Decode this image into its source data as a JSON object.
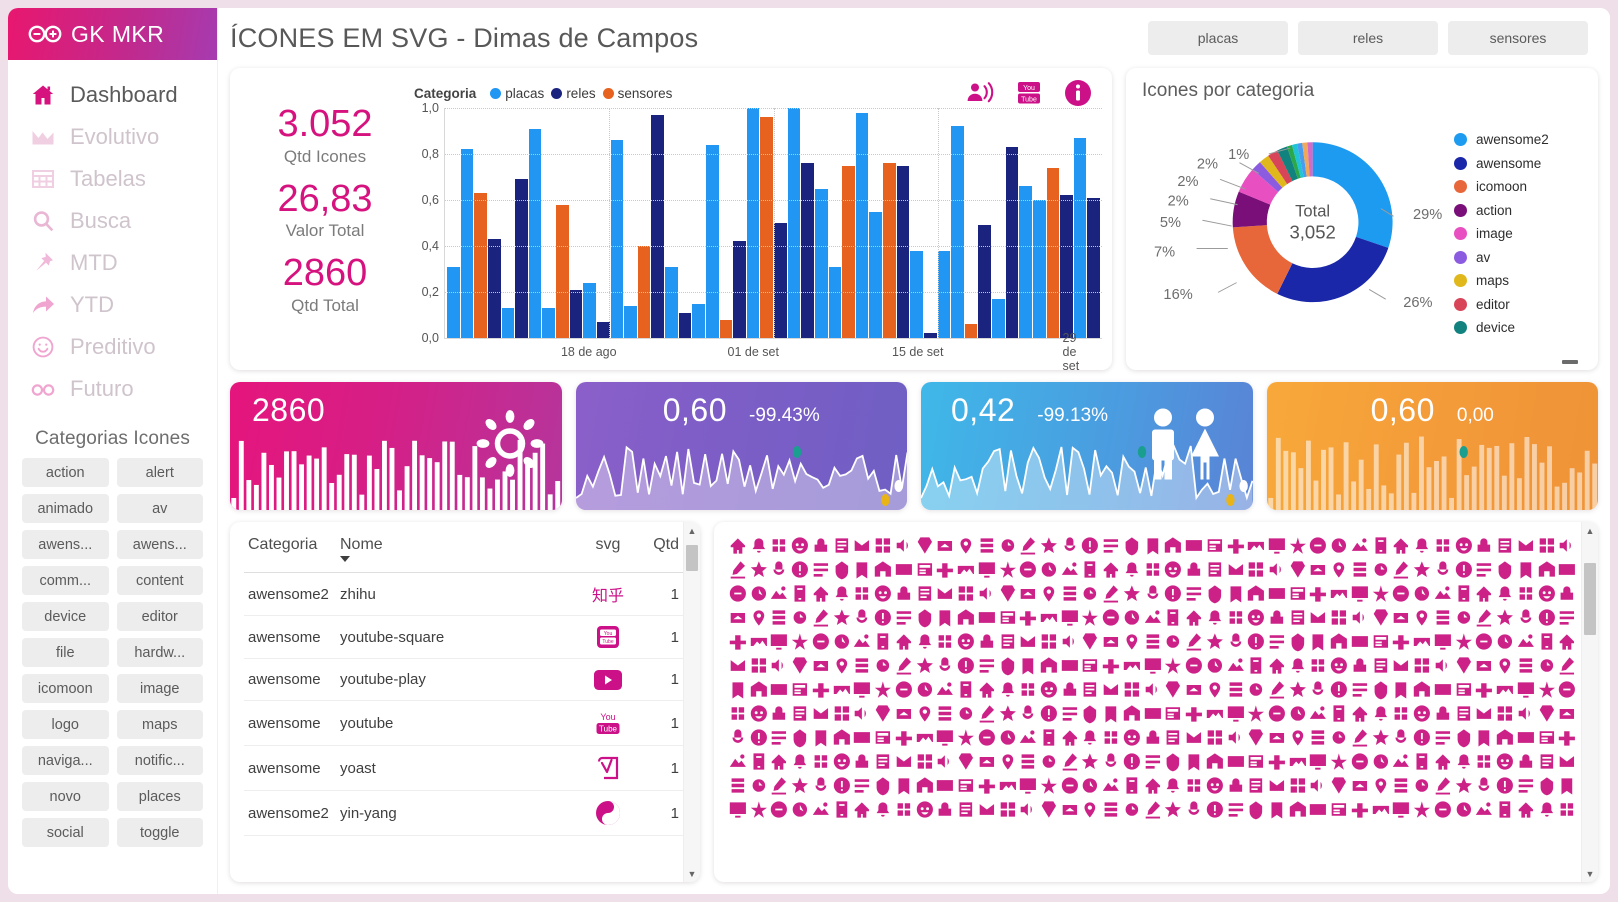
{
  "brand": {
    "title": "GK MKR",
    "logo_icon": "infinity-logo-icon"
  },
  "sidebar": {
    "nav": [
      {
        "label": "Dashboard",
        "icon": "home-icon",
        "active": true
      },
      {
        "label": "Evolutivo",
        "icon": "area-chart-icon",
        "active": false
      },
      {
        "label": "Tabelas",
        "icon": "table-icon",
        "active": false
      },
      {
        "label": "Busca",
        "icon": "search-icon",
        "active": false
      },
      {
        "label": "MTD",
        "icon": "pin-icon",
        "active": false
      },
      {
        "label": "YTD",
        "icon": "arrow-forward-icon",
        "active": false
      },
      {
        "label": "Preditivo",
        "icon": "smiley-icon",
        "active": false
      },
      {
        "label": "Futuro",
        "icon": "infinity-icon",
        "active": false
      }
    ],
    "categories_title": "Categorias Icones",
    "categories": [
      "action",
      "alert",
      "animado",
      "av",
      "awens...",
      "awens...",
      "comm...",
      "content",
      "device",
      "editor",
      "file",
      "hardw...",
      "icomoon",
      "image",
      "logo",
      "maps",
      "naviga...",
      "notific...",
      "novo",
      "places",
      "social",
      "toggle"
    ]
  },
  "header": {
    "title": "ÍCONES EM SVG - Dimas de Campos",
    "buttons": [
      "placas",
      "reles",
      "sensores"
    ]
  },
  "kpis": [
    {
      "value": "3.052",
      "label": "Qtd Icones"
    },
    {
      "value": "26,83",
      "label": "Valor Total"
    },
    {
      "value": "2860",
      "label": "Qtd Total"
    }
  ],
  "chart_data": [
    {
      "type": "bar",
      "title": "",
      "legend_caption": "Categoria",
      "legend_position": "top",
      "series": [
        {
          "name": "placas",
          "color": "#2196f3"
        },
        {
          "name": "reles",
          "color": "#1a237e"
        },
        {
          "name": "sensores",
          "color": "#e8621f"
        }
      ],
      "ylabel": "",
      "xlabel": "",
      "ylim": [
        0,
        1.0
      ],
      "yticks": [
        "0,0",
        "0,2",
        "0,4",
        "0,6",
        "0,8",
        "1,0"
      ],
      "xticks": [
        "18 de ago",
        "01 de set",
        "15 de set",
        "29 de set"
      ],
      "grid": true,
      "bars": [
        {
          "s": "placas",
          "v": 0.31
        },
        {
          "s": "placas",
          "v": 0.82
        },
        {
          "s": "sensores",
          "v": 0.63
        },
        {
          "s": "reles",
          "v": 0.43
        },
        {
          "s": "placas",
          "v": 0.13
        },
        {
          "s": "reles",
          "v": 0.69
        },
        {
          "s": "placas",
          "v": 0.91
        },
        {
          "s": "placas",
          "v": 0.13
        },
        {
          "s": "sensores",
          "v": 0.58
        },
        {
          "s": "reles",
          "v": 0.21
        },
        {
          "s": "placas",
          "v": 0.24
        },
        {
          "s": "reles",
          "v": 0.07
        },
        {
          "s": "placas",
          "v": 0.86
        },
        {
          "s": "placas",
          "v": 0.14
        },
        {
          "s": "sensores",
          "v": 0.4
        },
        {
          "s": "reles",
          "v": 0.97
        },
        {
          "s": "placas",
          "v": 0.31
        },
        {
          "s": "reles",
          "v": 0.11
        },
        {
          "s": "placas",
          "v": 0.15
        },
        {
          "s": "placas",
          "v": 0.84
        },
        {
          "s": "sensores",
          "v": 0.08
        },
        {
          "s": "reles",
          "v": 0.42
        },
        {
          "s": "placas",
          "v": 1.0
        },
        {
          "s": "sensores",
          "v": 0.96
        },
        {
          "s": "reles",
          "v": 0.5
        },
        {
          "s": "placas",
          "v": 1.0
        },
        {
          "s": "reles",
          "v": 0.76
        },
        {
          "s": "placas",
          "v": 0.65
        },
        {
          "s": "placas",
          "v": 0.31
        },
        {
          "s": "sensores",
          "v": 0.75
        },
        {
          "s": "placas",
          "v": 0.98
        },
        {
          "s": "placas",
          "v": 0.55
        },
        {
          "s": "sensores",
          "v": 0.76
        },
        {
          "s": "reles",
          "v": 0.75
        },
        {
          "s": "placas",
          "v": 0.38
        },
        {
          "s": "reles",
          "v": 0.02
        },
        {
          "s": "placas",
          "v": 0.38
        },
        {
          "s": "placas",
          "v": 0.92
        },
        {
          "s": "sensores",
          "v": 0.06
        },
        {
          "s": "reles",
          "v": 0.49
        },
        {
          "s": "placas",
          "v": 0.17
        },
        {
          "s": "reles",
          "v": 0.83
        },
        {
          "s": "placas",
          "v": 0.66
        },
        {
          "s": "placas",
          "v": 0.6
        },
        {
          "s": "sensores",
          "v": 0.74
        },
        {
          "s": "reles",
          "v": 0.62
        },
        {
          "s": "placas",
          "v": 0.87
        },
        {
          "s": "reles",
          "v": 0.61
        }
      ]
    },
    {
      "type": "pie",
      "title": "Icones por categoria",
      "center_label": "Total",
      "center_value": "3,052",
      "legend_position": "right",
      "labels": [
        "awensome2",
        "awensome",
        "icomoon",
        "action",
        "image",
        "av",
        "maps",
        "editor",
        "device"
      ],
      "values": [
        29,
        26,
        16,
        7,
        5,
        2,
        2,
        2,
        2
      ],
      "extra_values": [
        1,
        1,
        1,
        1,
        1
      ],
      "callout_labels": [
        "29%",
        "26%",
        "16%",
        "7%",
        "5%",
        "2%",
        "2%",
        "2%",
        "1%"
      ],
      "colors": [
        "#1d9bf0",
        "#1a27a8",
        "#e8673a",
        "#7a0f7a",
        "#e84fc0",
        "#8c5ce0",
        "#e0b81c",
        "#d84458",
        "#12827f",
        "#2aa84a",
        "#21c4d6",
        "#4a9cf0",
        "#f2a85a",
        "#d46ac8",
        "#7a5fd6",
        "#c9a82a"
      ]
    }
  ],
  "tiles": [
    {
      "value": "2860",
      "delta": "",
      "icon": "sun-icon",
      "type": "bars"
    },
    {
      "value": "0,60",
      "delta": "-99.43%",
      "icon": "",
      "type": "line"
    },
    {
      "value": "0,42",
      "delta": "-99.13%",
      "icon": "people-icon",
      "type": "line"
    },
    {
      "value": "0,60",
      "delta": "0,00",
      "icon": "",
      "type": "bars"
    }
  ],
  "table": {
    "columns": [
      "Categoria",
      "Nome",
      "svg",
      "Qtd"
    ],
    "sorted_column": "Nome",
    "rows": [
      {
        "categoria": "awensome2",
        "nome": "zhihu",
        "svg": "zhihu-icon",
        "qtd": "1"
      },
      {
        "categoria": "awensome",
        "nome": "youtube-square",
        "svg": "youtube-square-icon",
        "qtd": "1"
      },
      {
        "categoria": "awensome",
        "nome": "youtube-play",
        "svg": "youtube-play-icon",
        "qtd": "1"
      },
      {
        "categoria": "awensome",
        "nome": "youtube",
        "svg": "youtube-icon",
        "qtd": "1"
      },
      {
        "categoria": "awensome",
        "nome": "yoast",
        "svg": "yoast-icon",
        "qtd": "1"
      },
      {
        "categoria": "awensome2",
        "nome": "yin-yang",
        "svg": "yin-yang-icon",
        "qtd": "1"
      }
    ]
  },
  "icon_gallery": {
    "icon_color": "#cc2288",
    "rows": 12,
    "cols": 41
  },
  "colors": {
    "brand_start": "#e8176f",
    "brand_end": "#a63bb0",
    "accent": "#d6127f",
    "placas": "#2196f3",
    "reles": "#1a237e",
    "sensores": "#e8621f",
    "page_bg": "#efdfe9"
  }
}
